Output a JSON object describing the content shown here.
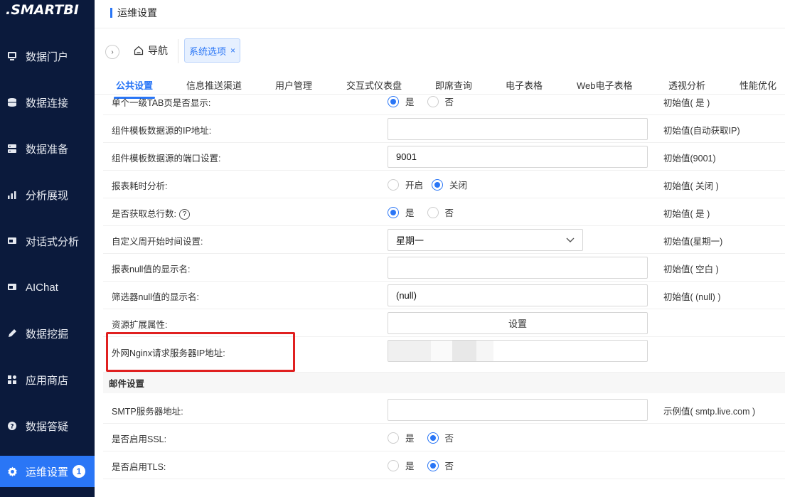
{
  "brand": {
    "logo_text": ".SMARTBI"
  },
  "sidebar": {
    "items": [
      {
        "label": "数据门户",
        "icon": "monitor-icon"
      },
      {
        "label": "数据连接",
        "icon": "database-icon"
      },
      {
        "label": "数据准备",
        "icon": "server-icon"
      },
      {
        "label": "分析展现",
        "icon": "bar-chart-icon"
      },
      {
        "label": "对话式分析",
        "icon": "chat-icon"
      },
      {
        "label": "AIChat",
        "icon": "ai-chat-icon"
      },
      {
        "label": "数据挖掘",
        "icon": "pen-icon"
      },
      {
        "label": "应用商店",
        "icon": "app-store-icon"
      },
      {
        "label": "数据答疑",
        "icon": "question-icon"
      },
      {
        "label": "运维设置",
        "icon": "gear-icon",
        "badge": "1"
      }
    ]
  },
  "header": {
    "title": "运维设置"
  },
  "tabs": {
    "nav_label": "导航",
    "system_tab": "系统选项",
    "close_glyph": "×",
    "expand_glyph": "›"
  },
  "sub_tabs": [
    "公共设置",
    "信息推送渠道",
    "用户管理",
    "交互式仪表盘",
    "即席查询",
    "电子表格",
    "Web电子表格",
    "透视分析",
    "性能优化"
  ],
  "settings": {
    "row_tab_display": {
      "label": "单个一级TAB页是否显示:",
      "options": [
        "是",
        "否"
      ],
      "initial": "初始值( 是 )"
    },
    "row_template_ip": {
      "label": "组件模板数据源的IP地址:",
      "value": "",
      "initial": "初始值(自动获取IP)"
    },
    "row_template_port": {
      "label": "组件模板数据源的端口设置:",
      "value": "9001",
      "initial": "初始值(9001)"
    },
    "row_report_timing": {
      "label": "报表耗时分析:",
      "options": [
        "开启",
        "关闭"
      ],
      "initial": "初始值( 关闭 )"
    },
    "row_total_rows": {
      "label": "是否获取总行数:",
      "options": [
        "是",
        "否"
      ],
      "initial": "初始值( 是 )"
    },
    "row_week_start": {
      "label": "自定义周开始时间设置:",
      "value": "星期一",
      "initial": "初始值(星期一)"
    },
    "row_report_null": {
      "label": "报表null值的显示名:",
      "value": "",
      "initial": "初始值( 空白 )"
    },
    "row_filter_null": {
      "label": "筛选器null值的显示名:",
      "value": "(null)",
      "initial": "初始值( (null) )"
    },
    "row_resource_ext": {
      "label": "资源扩展属性:",
      "button": "设置"
    },
    "row_nginx_ip": {
      "label": "外网Nginx请求服务器IP地址:"
    },
    "mail_section": {
      "title": "邮件设置"
    },
    "row_smtp": {
      "label": "SMTP服务器地址:",
      "value": "",
      "initial": "示例值( smtp.live.com )"
    },
    "row_ssl": {
      "label": "是否启用SSL:",
      "options": [
        "是",
        "否"
      ]
    },
    "row_tls": {
      "label": "是否启用TLS:",
      "options": [
        "是",
        "否"
      ]
    }
  },
  "colors": {
    "sidebar_bg": "#0b1a3c",
    "accent": "#2a76f6",
    "highlight": "#e02020"
  }
}
